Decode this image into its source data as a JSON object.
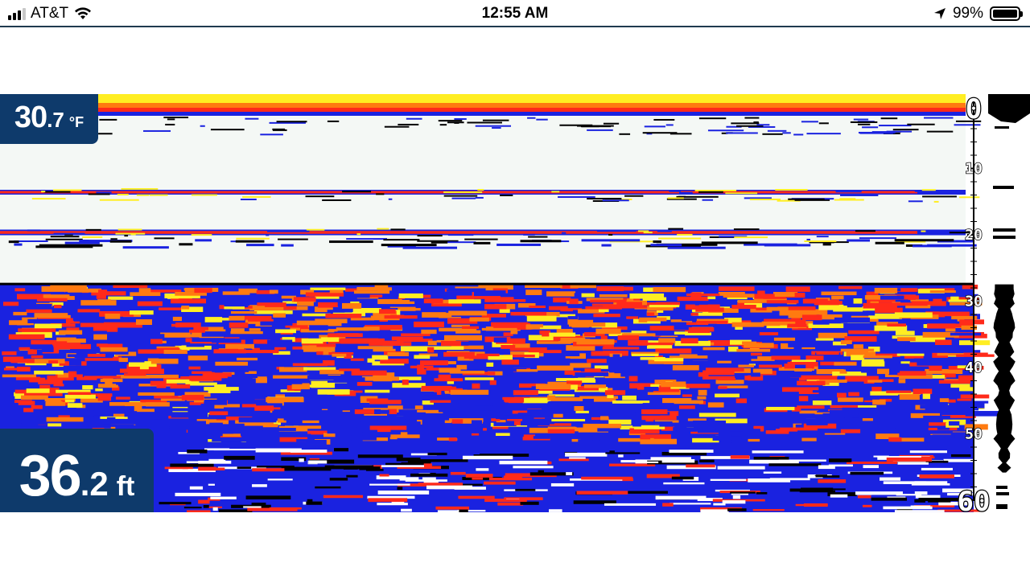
{
  "status_bar": {
    "carrier": "AT&T",
    "time": "12:55 AM",
    "battery_percent": "99%",
    "battery_level": 0.99,
    "signal_bars": 3,
    "signal_total": 4
  },
  "readouts": {
    "water_temp_int": "30",
    "water_temp_dec": ".7",
    "water_temp_unit": "°F",
    "depth_int": "36",
    "depth_dec": ".2",
    "depth_unit": "ft"
  },
  "depth_scale": {
    "labels": [
      "0",
      "10",
      "20",
      "30",
      "40",
      "50",
      "60"
    ],
    "min": 0,
    "max": 60
  },
  "colors": {
    "badge_bg": "#0e3a6b",
    "sonar_yellow": "#ffee22",
    "sonar_red": "#ff2a1a",
    "sonar_orange": "#ff7a10",
    "sonar_blue": "#1a22e0",
    "sonar_water": "#f4f8f5"
  }
}
